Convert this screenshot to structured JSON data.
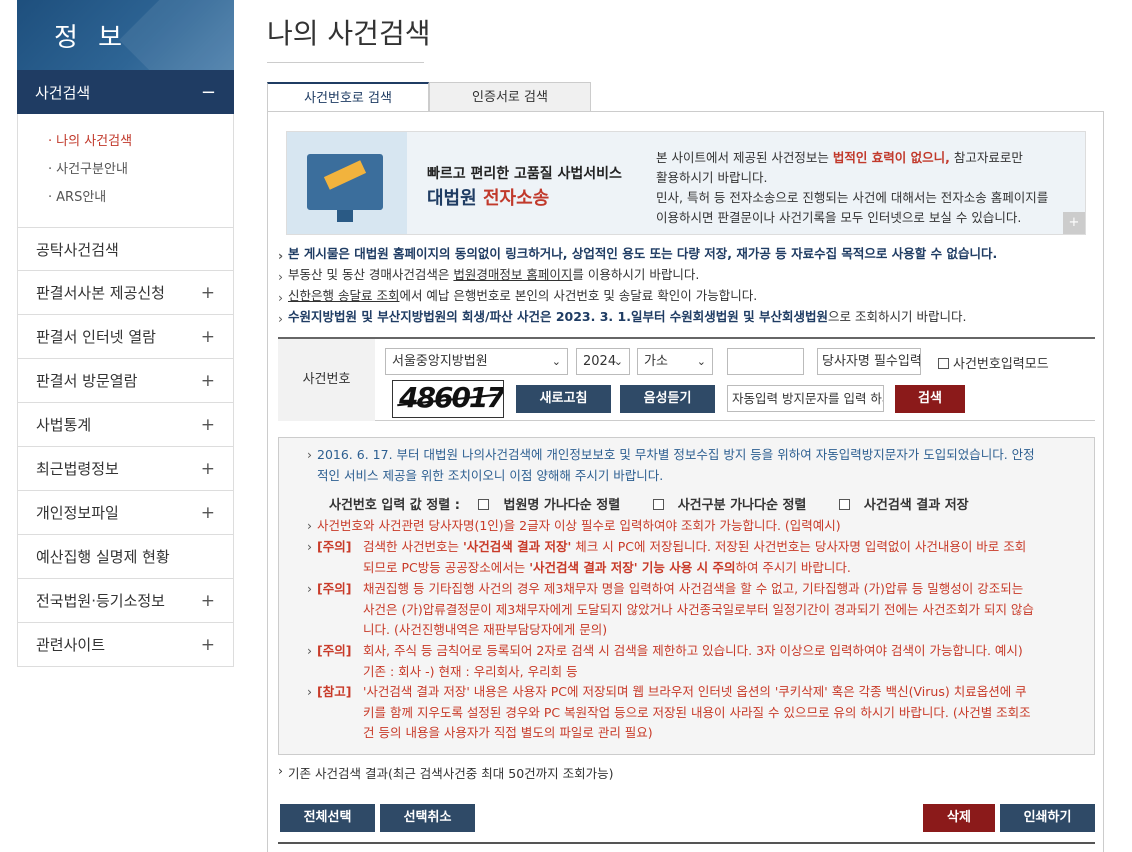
{
  "sidebar": {
    "title": "정 보",
    "active": {
      "label": "사건검색",
      "toggle": "−"
    },
    "sub": [
      "나의 사건검색",
      "사건구분안내",
      "ARS안내"
    ],
    "items": [
      {
        "label": "공탁사건검색",
        "toggle": ""
      },
      {
        "label": "판결서사본 제공신청",
        "toggle": "+"
      },
      {
        "label": "판결서 인터넷 열람",
        "toggle": "+"
      },
      {
        "label": "판결서 방문열람",
        "toggle": "+"
      },
      {
        "label": "사법통계",
        "toggle": "+"
      },
      {
        "label": "최근법령정보",
        "toggle": "+"
      },
      {
        "label": "개인정보파일",
        "toggle": "+"
      },
      {
        "label": "예산집행 실명제 현황",
        "toggle": ""
      },
      {
        "label": "전국법원·등기소정보",
        "toggle": "+"
      },
      {
        "label": "관련사이트",
        "toggle": "+"
      }
    ]
  },
  "page": {
    "title": "나의 사건검색"
  },
  "tabs": [
    "사건번호로 검색",
    "인증서로 검색"
  ],
  "banner": {
    "line1": "빠르고 편리한 고품질 사법서비스",
    "line2a": "대법원 ",
    "line2b": "전자소송",
    "t1": "본 사이트에서 제공된 사건정보는 ",
    "t1em": "법적인 효력이 없으니,",
    "t1b": " 참고자료로만",
    "t2": "활용하시기 바랍니다.",
    "t3": "민사, 특허 등 전자소송으로 진행되는 사건에 대해서는 전자소송 홈페이지를",
    "t4": "이용하시면 판결문이나 사건기록을 모두 인터넷으로 보실 수 있습니다.",
    "plus": "+"
  },
  "notices": {
    "n1": "본 게시물은 대법원 홈페이지의 동의없이 링크하거나, 상업적인 용도 또는 다량 저장, 재가공 등 자료수집 목적으로 사용할 수 없습니다.",
    "n2a": "부동산 및 동산 경매사건검색은 ",
    "n2link": "법원경매정보 홈페이지",
    "n2b": "를 이용하시기 바랍니다.",
    "n3link": "신한은행 송달료 조회",
    "n3b": "에서 예납 은행번호로 본인의 사건번호 및 송달료 확인이 가능합니다.",
    "n4a": "수원지방법원 및 부산지방법원의 회생/파산 사건은 2023. 3. 1.일부터 수원회생법원 및 부산회생법원",
    "n4b": "으로 조회하시기 바랍니다."
  },
  "search": {
    "label": "사건번호",
    "court": "서울중앙지방법원",
    "year": "2024",
    "type": "가소",
    "number": "",
    "party_placeholder": "당사자명 필수입력",
    "mode_label": "사건번호입력모드",
    "captcha": "486017",
    "refresh": "새로고침",
    "audio": "음성듣기",
    "captcha_placeholder": "자동입력 방지문자를 입력 하세요",
    "submit": "검색"
  },
  "info": {
    "p1": "2016. 6. 17. 부터 대법원 나의사건검색에 개인정보보호 및 무차별 정보수집 방지 등을 위하여 자동입력방지문자가 도입되었습니다. 안정적인 서비스 제공을 위한 조치이오니 이점 양해해 주시기 바랍니다.",
    "sort_label": "사건번호 입력 값 정렬 :",
    "sort1": "법원명 가나다순 정렬",
    "sort2": "사건구분 가나다순 정렬",
    "sort3": "사건검색 결과 저장",
    "p2": "사건번호와 사건관련 당사자명(1인)을 2글자 이상 필수로 입력하여야 조회가 가능합니다. (입력예시)",
    "tag_note": "[주의]",
    "tag_ref": "[참고]",
    "c1a": "검색한 사건번호는 ",
    "c1b": "'사건검색 결과 저장'",
    "c1c": " 체크 시 PC에 저장됩니다. 저장된 사건번호는 당사자명 입력없이 사건내용이 바로 조회 되므로 PC방등 공공장소에서는 ",
    "c1d": "'사건검색 결과 저장' 기능 사용 시 주의",
    "c1e": "하여 주시기 바랍니다.",
    "c2": "채권집행 등 기타집행 사건의 경우 제3채무자 명을 입력하여 사건검색을 할 수 없고, 기타집행과 (가)압류 등 밀행성이 강조되는 사건은 (가)압류결정문이 제3채무자에게 도달되지 않았거나 사건종국일로부터 일정기간이 경과되기 전에는 사건조회가 되지 않습니다. (사건진행내역은 재판부담당자에게 문의)",
    "c3": "회사, 주식 등 금칙어로 등록되어 2자로 검색 시 검색을 제한하고 있습니다. 3자 이상으로 입력하여야 검색이 가능합니다. 예시) 기존 : 회사 -) 현재 : 우리회사, 우리회 등",
    "c4": "'사건검색 결과 저장' 내용은 사용자 PC에 저장되며 웹 브라우저 인터넷 옵션의 '쿠키삭제' 혹은 각종 백신(Virus) 치료옵션에 쿠키를 함께 지우도록 설정된 경우와 PC 복원작업 등으로 저장된 내용이 사라질 수 있으므로 유의 하시기 바랍니다. (사건별 조회조건 등의 내용을 사용자가 직접 별도의 파일로 관리 필요)"
  },
  "prev": "기존 사건검색 결과(최근 검색사건중 최대 50건까지 조회가능)",
  "actions": {
    "select_all": "전체선택",
    "deselect": "선택취소",
    "delete": "삭제",
    "print": "인쇄하기"
  }
}
